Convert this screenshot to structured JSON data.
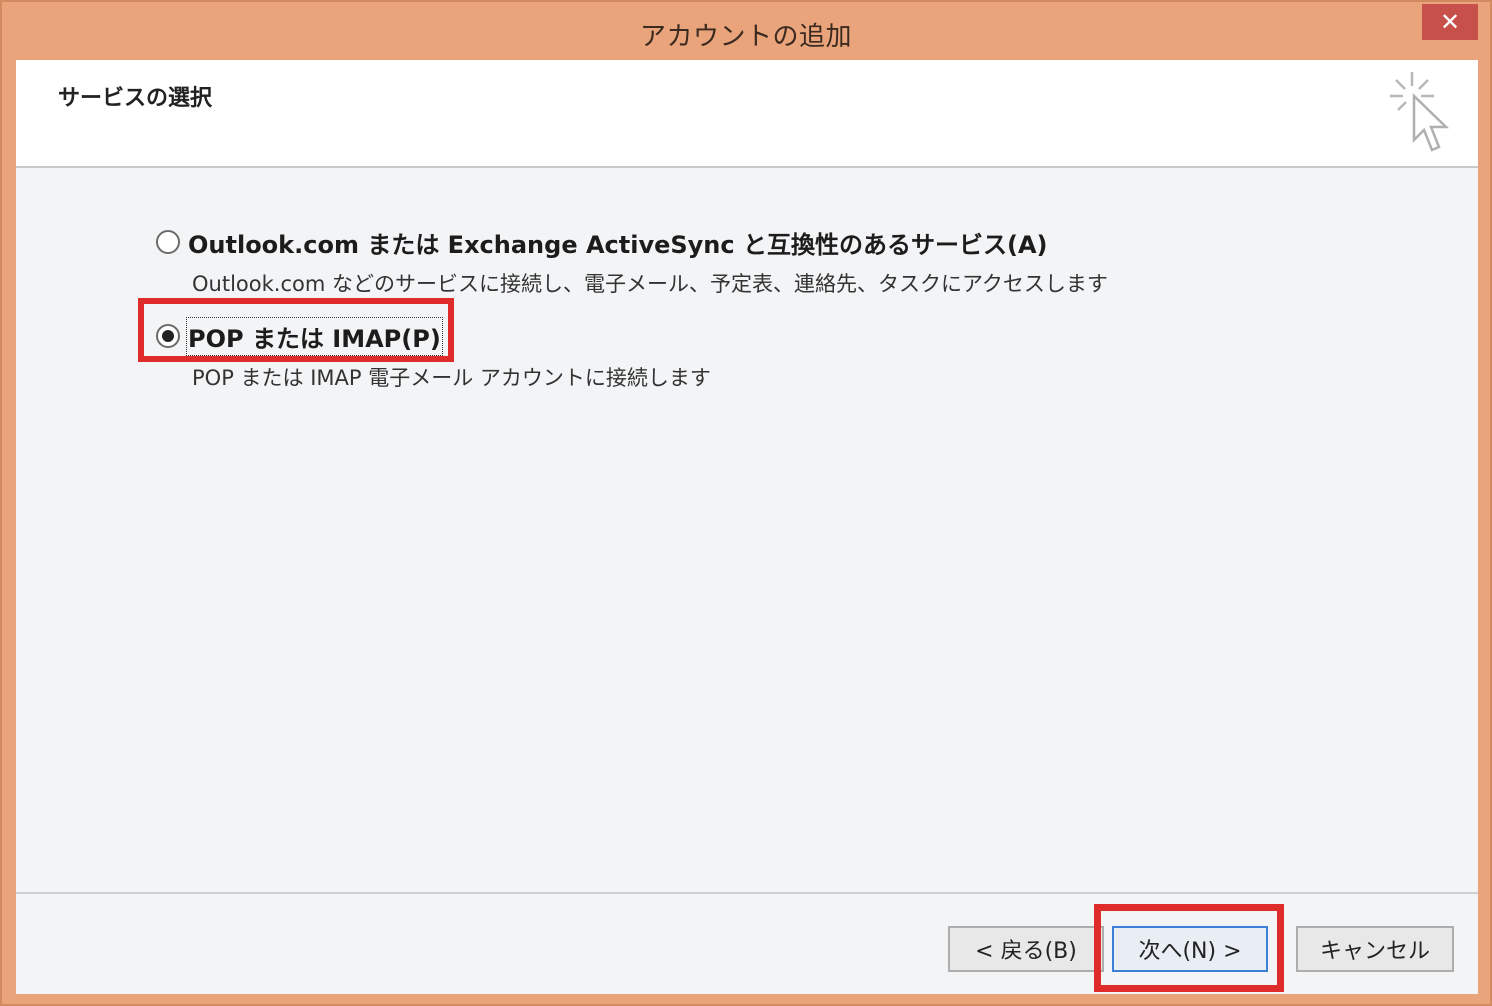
{
  "window": {
    "title": "アカウントの追加",
    "close_glyph": "✕"
  },
  "header": {
    "title": "サービスの選択",
    "icon": "pointer-sparkle-icon"
  },
  "options": [
    {
      "label": "Outlook.com または Exchange ActiveSync と互換性のあるサービス(A)",
      "description": "Outlook.com などのサービスに接続し、電子メール、予定表、連絡先、タスクにアクセスします",
      "selected": false
    },
    {
      "label": "POP または IMAP(P)",
      "description": "POP または IMAP 電子メール アカウントに接続します",
      "selected": true
    }
  ],
  "buttons": {
    "back": "< 戻る(B)",
    "next": "次へ(N) >",
    "cancel": "キャンセル"
  },
  "colors": {
    "accent": "#e02b2b",
    "frame": "#e9a47b"
  }
}
